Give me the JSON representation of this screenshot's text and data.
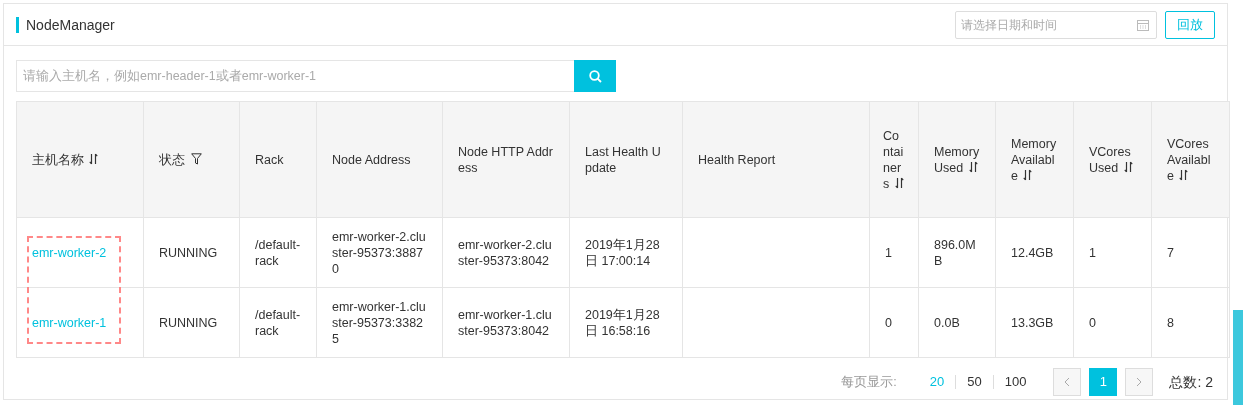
{
  "panel": {
    "title": "NodeManager",
    "date_picker": {
      "placeholder": "请选择日期和时间"
    },
    "replay_button": "回放"
  },
  "search": {
    "placeholder": "请输入主机名，例如emr-header-1或者emr-worker-1"
  },
  "table": {
    "columns": [
      {
        "label": "主机名称",
        "sortable": true,
        "filterable": false
      },
      {
        "label": "状态",
        "sortable": false,
        "filterable": true
      },
      {
        "label": "Rack",
        "sortable": false,
        "filterable": false
      },
      {
        "label": "Node Address",
        "sortable": false,
        "filterable": false
      },
      {
        "label": "Node HTTP Address",
        "sortable": false,
        "filterable": false
      },
      {
        "label": "Last Health Update",
        "sortable": false,
        "filterable": false
      },
      {
        "label": "Health Report",
        "sortable": false,
        "filterable": false
      },
      {
        "label": "Containers",
        "sortable": true,
        "filterable": false
      },
      {
        "label": "Memory Used",
        "sortable": true,
        "filterable": false
      },
      {
        "label": "Memory Available",
        "sortable": true,
        "filterable": false
      },
      {
        "label": "VCores Used",
        "sortable": true,
        "filterable": false
      },
      {
        "label": "VCores Available",
        "sortable": true,
        "filterable": false
      }
    ],
    "rows": [
      [
        "emr-worker-2",
        "RUNNING",
        "/default-rack",
        "emr-worker-2.cluster-95373:38870",
        "emr-worker-2.cluster-95373:8042",
        "2019年1月28日 17:00:14",
        "",
        "1",
        "896.0MB",
        "12.4GB",
        "1",
        "7"
      ],
      [
        "emr-worker-1",
        "RUNNING",
        "/default-rack",
        "emr-worker-1.cluster-95373:33825",
        "emr-worker-1.cluster-95373:8042",
        "2019年1月28日 16:58:16",
        "",
        "0",
        "0.0B",
        "13.3GB",
        "0",
        "8"
      ]
    ]
  },
  "pagination": {
    "page_size_label": "每页显示:",
    "page_sizes": [
      {
        "label": "20",
        "selected": true
      },
      {
        "label": "50",
        "selected": false
      },
      {
        "label": "100",
        "selected": false
      }
    ],
    "pages": [
      {
        "label": "1",
        "selected": true
      }
    ],
    "total": "总数: 2"
  }
}
